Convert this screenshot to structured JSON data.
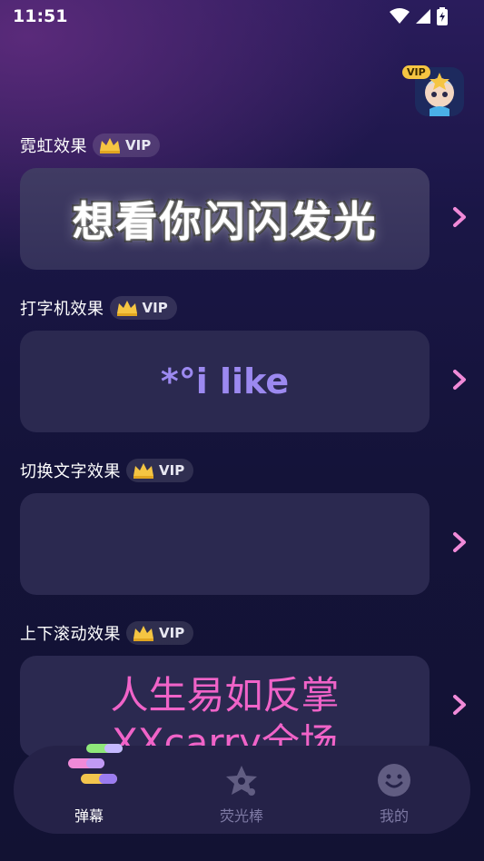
{
  "status_bar": {
    "time": "11:51"
  },
  "avatar": {
    "vip_label": "VIP"
  },
  "sections": [
    {
      "title": "霓虹效果",
      "vip": "VIP",
      "preview_text": "想看你闪闪发光"
    },
    {
      "title": "打字机效果",
      "vip": "VIP",
      "preview_text": "*°i like"
    },
    {
      "title": "切换文字效果",
      "vip": "VIP",
      "preview_text": ""
    },
    {
      "title": "上下滚动效果",
      "vip": "VIP",
      "preview_line1": "人生易如反掌",
      "preview_line2": "XXcarry全场"
    }
  ],
  "tabbar": {
    "tabs": [
      {
        "label": "弹幕",
        "active": true
      },
      {
        "label": "荧光棒",
        "active": false
      },
      {
        "label": "我的",
        "active": false
      }
    ]
  },
  "colors": {
    "vip_gold": "#f5c542",
    "accent_purple": "#9c89f0",
    "scroll_pink": "#f063c8",
    "chevron_pink": "#f08ad8"
  }
}
